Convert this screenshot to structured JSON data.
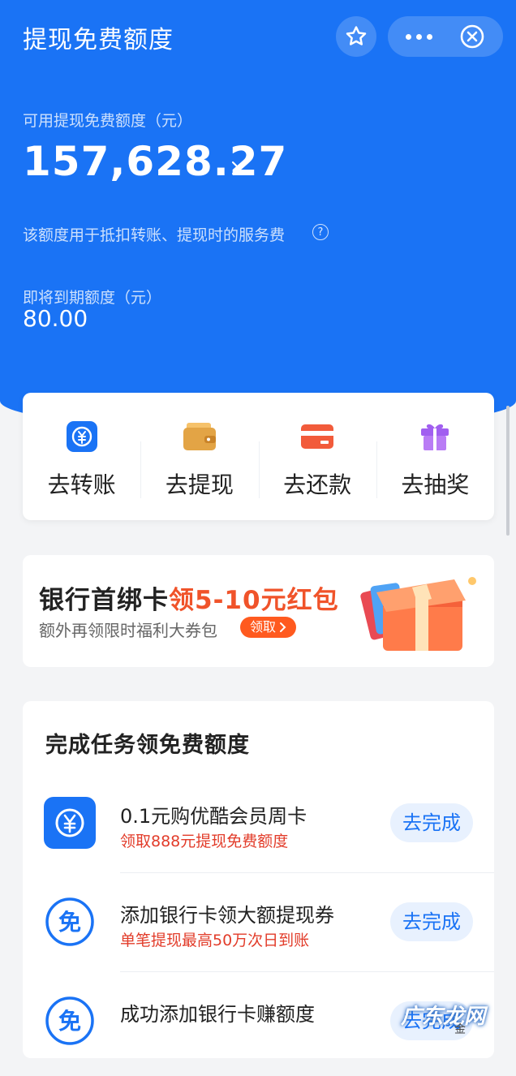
{
  "header": {
    "title": "提现免费额度",
    "favorite_icon": "star-icon",
    "more_icon": "more-dots-icon",
    "close_icon": "close-circle-icon"
  },
  "summary": {
    "available_label": "可用提现免费额度（元）",
    "available_amount": "157,628.27",
    "usage_note": "该额度用于抵扣转账、提现时的服务费",
    "expiring_label": "即将到期额度（元）",
    "expiring_amount": "80.00"
  },
  "actions": [
    {
      "label": "去转账",
      "icon": "transfer-yuan-icon"
    },
    {
      "label": "去提现",
      "icon": "wallet-icon"
    },
    {
      "label": "去还款",
      "icon": "card-icon"
    },
    {
      "label": "去抽奖",
      "icon": "gift-icon"
    }
  ],
  "banner": {
    "title_main": "银行首绑卡",
    "title_highlight": "领5-10元红包",
    "subtitle": "额外再领限时福利大券包",
    "claim_label": "领取"
  },
  "tasks": {
    "title": "完成任务领免费额度",
    "items": [
      {
        "name": "0.1元购优酷会员周卡",
        "desc": "领取888元提现免费额度",
        "button": "去完成",
        "icon": "yuan-icon"
      },
      {
        "name": "添加银行卡领大额提现券",
        "desc": "单笔提现最高50万次日到账",
        "button": "去完成",
        "icon": "free-badge-icon",
        "icon_text": "免"
      },
      {
        "name": "成功添加银行卡赚额度",
        "desc": "",
        "button": "去完成",
        "icon": "free-badge-icon",
        "icon_text": "免"
      }
    ]
  },
  "watermark": {
    "text": "广东龙网",
    "small": "金"
  },
  "colors": {
    "brand_blue": "#1a73f5",
    "accent_red": "#e23c2a",
    "accent_orange": "#ff5a1f"
  }
}
